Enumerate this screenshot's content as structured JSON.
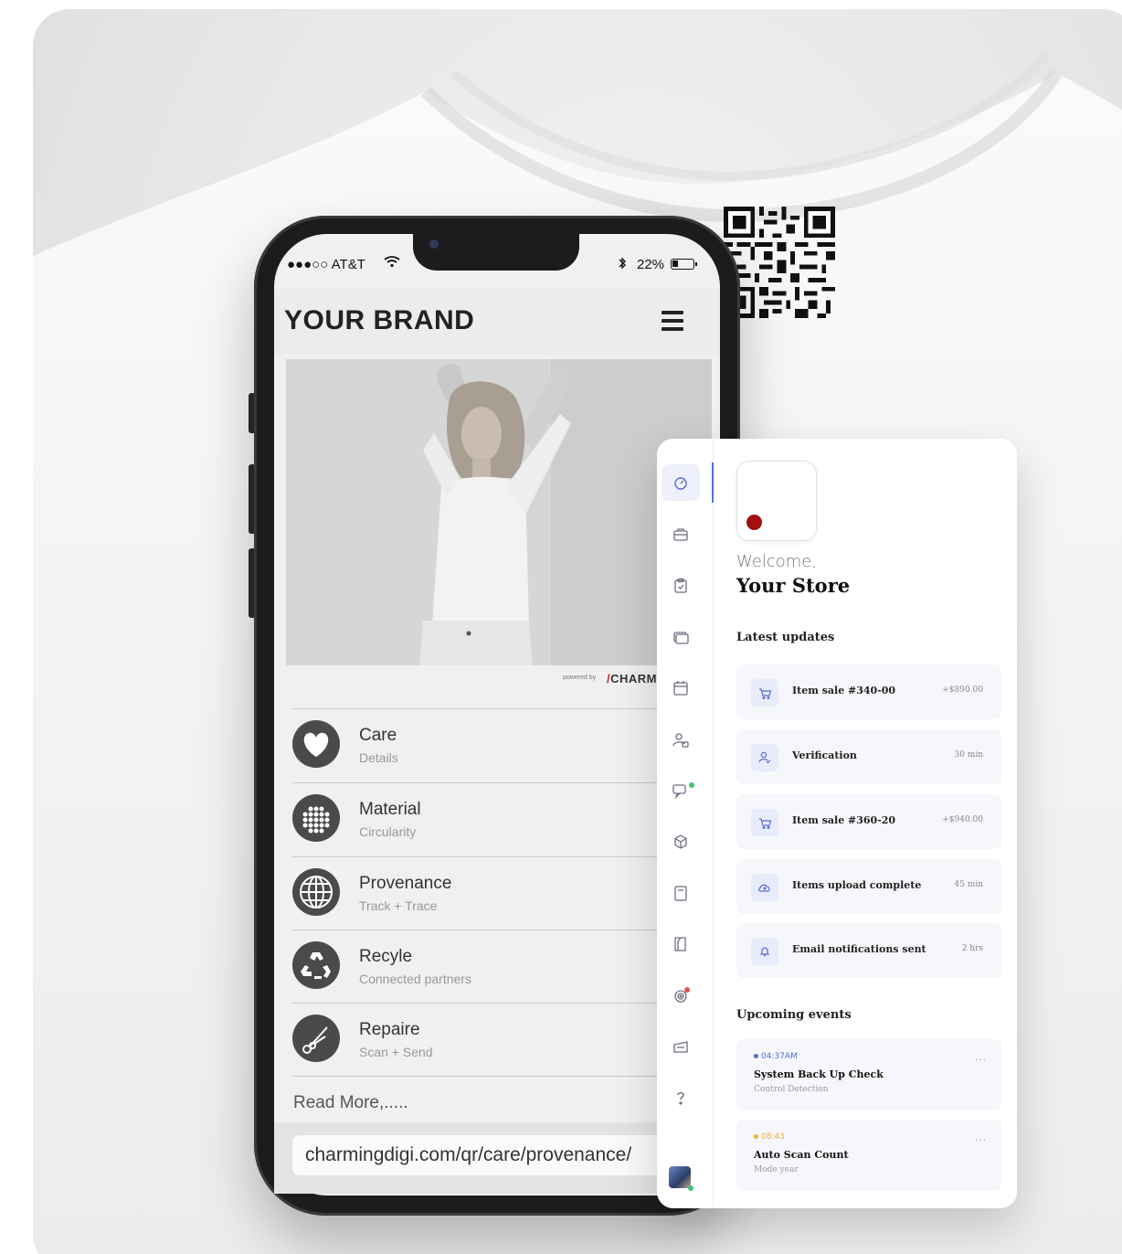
{
  "phone": {
    "status": {
      "carrier": "●●●○○ AT&T",
      "battery": "22%"
    },
    "brand": "YOUR BRAND",
    "powered_by": "powered by",
    "powered_brand": "CHARM",
    "menu": [
      {
        "title": "Care",
        "subtitle": "Details",
        "icon": "heart-icon"
      },
      {
        "title": "Material",
        "subtitle": "Circularity",
        "icon": "grid-dots-icon"
      },
      {
        "title": "Provenance",
        "subtitle": "Track + Trace",
        "icon": "globe-icon"
      },
      {
        "title": "Recyle",
        "subtitle": "Connected partners",
        "icon": "recycle-icon"
      },
      {
        "title": "Repaire",
        "subtitle": "Scan + Send",
        "icon": "scissors-icon"
      }
    ],
    "read_more": "Read More,.....",
    "url": "charmingdigi.com/qr/care/provenance/"
  },
  "dashboard": {
    "welcome": "Welcome,",
    "store": "Your Store",
    "latest_title": "Latest updates",
    "updates": [
      {
        "label": "Item sale #340-00",
        "value": "+$890.00",
        "icon": "cart-icon"
      },
      {
        "label": "Verification",
        "value": "30 min",
        "icon": "user-check-icon"
      },
      {
        "label": "Item sale #360-20",
        "value": "+$940.00",
        "icon": "cart-icon"
      },
      {
        "label": "Items upload complete",
        "value": "45 min",
        "icon": "cloud-upload-icon"
      },
      {
        "label": "Email notifications sent",
        "value": "2 hrs",
        "icon": "bell-icon"
      }
    ],
    "events_title": "Upcoming events",
    "events": [
      {
        "time": "04:37AM",
        "title": "System Back Up Check",
        "subtitle": "Control Detection",
        "color": "#4c6fe0"
      },
      {
        "time": "08:43",
        "title": "Auto Scan Count",
        "subtitle": "Mode year",
        "color": "#f0b23a"
      }
    ],
    "more": "..."
  },
  "colors": {
    "accent": "#5a6bd6",
    "logo_dot": "#a01010",
    "online": "#46c27a",
    "alert": "#e45050"
  }
}
